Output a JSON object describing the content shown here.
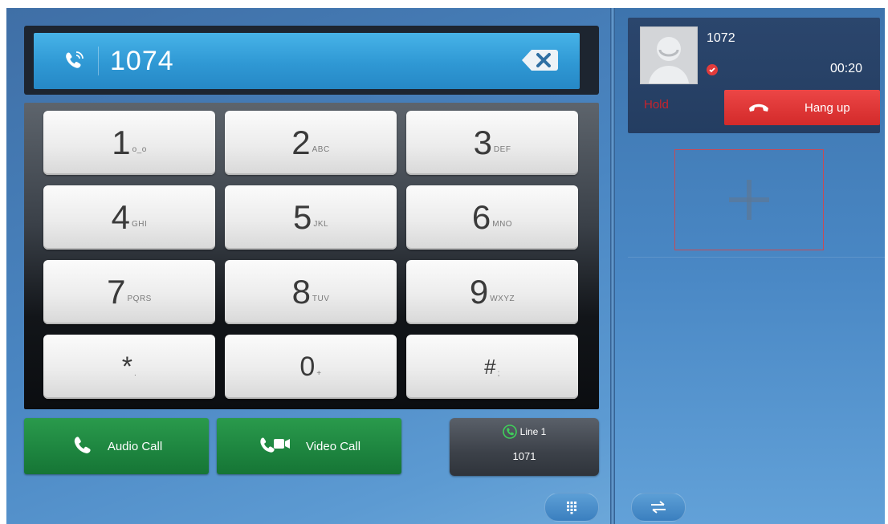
{
  "dialer": {
    "number": "1074",
    "keys": [
      {
        "digit": "1",
        "sub": "o_o"
      },
      {
        "digit": "2",
        "sub": "ABC"
      },
      {
        "digit": "3",
        "sub": "DEF"
      },
      {
        "digit": "4",
        "sub": "GHI"
      },
      {
        "digit": "5",
        "sub": "JKL"
      },
      {
        "digit": "6",
        "sub": "MNO"
      },
      {
        "digit": "7",
        "sub": "PQRS"
      },
      {
        "digit": "8",
        "sub": "TUV"
      },
      {
        "digit": "9",
        "sub": "WXYZ"
      },
      {
        "digit": "*",
        "sub": "."
      },
      {
        "digit": "0",
        "sub": "+"
      },
      {
        "digit": "#",
        "sub": ";"
      }
    ]
  },
  "actions": {
    "audio_call": "Audio Call",
    "video_call": "Video Call",
    "line_label": "Line 1",
    "line_number": "1071"
  },
  "active_call": {
    "caller": "1072",
    "duration": "00:20",
    "hold_label": "Hold",
    "hangup_label": "Hang up"
  },
  "icons": {
    "dial_icon": "phone-signal-icon",
    "backspace_icon": "backspace-icon",
    "audio_icon": "handset-icon",
    "video_icon": "video-call-icon",
    "line_icon": "line-status-icon",
    "keypad_toggle_icon": "keypad-icon",
    "swap_icon": "swap-icon",
    "add_icon": "plus-icon",
    "hangup_icon": "hangup-icon"
  },
  "colors": {
    "accent_blue": "#2f98d4",
    "call_green": "#1e8640",
    "hangup_red": "#d32a2a",
    "hold_red": "#c8232c"
  }
}
